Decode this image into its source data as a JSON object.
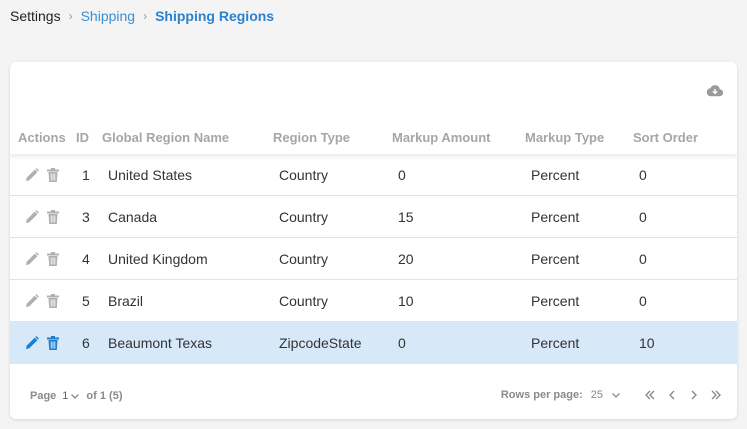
{
  "breadcrumb": {
    "root": "Settings",
    "parent": "Shipping",
    "current": "Shipping Regions",
    "separator": "›"
  },
  "table": {
    "headers": {
      "actions": "Actions",
      "id": "ID",
      "name": "Global Region Name",
      "region_type": "Region Type",
      "markup_amount": "Markup Amount",
      "markup_type": "Markup Type",
      "sort_order": "Sort Order"
    },
    "rows": [
      {
        "id": "1",
        "name": "United States",
        "region_type": "Country",
        "markup_amount": "0",
        "markup_type": "Percent",
        "sort_order": "0"
      },
      {
        "id": "3",
        "name": "Canada",
        "region_type": "Country",
        "markup_amount": "15",
        "markup_type": "Percent",
        "sort_order": "0"
      },
      {
        "id": "4",
        "name": "United Kingdom",
        "region_type": "Country",
        "markup_amount": "20",
        "markup_type": "Percent",
        "sort_order": "0"
      },
      {
        "id": "5",
        "name": "Brazil",
        "region_type": "Country",
        "markup_amount": "10",
        "markup_type": "Percent",
        "sort_order": "0"
      },
      {
        "id": "6",
        "name": "Beaumont Texas",
        "region_type": "ZipcodeState",
        "markup_amount": "0",
        "markup_type": "Percent",
        "sort_order": "10"
      }
    ],
    "selected_row_index": 4
  },
  "pagination": {
    "page_label": "Page",
    "page_value": "1",
    "of_label": "of 1 (5)",
    "rows_per_page_label": "Rows per page:",
    "rows_per_page_value": "25"
  },
  "icons": {
    "toolbar": "cloud-download-icon",
    "edit": "pencil-icon",
    "delete": "trash-icon"
  },
  "colors": {
    "link": "#3a8fd6",
    "selected_row": "#d7e9f9",
    "icon_idle": "#b0b0b0",
    "icon_active": "#1e7fd0"
  }
}
